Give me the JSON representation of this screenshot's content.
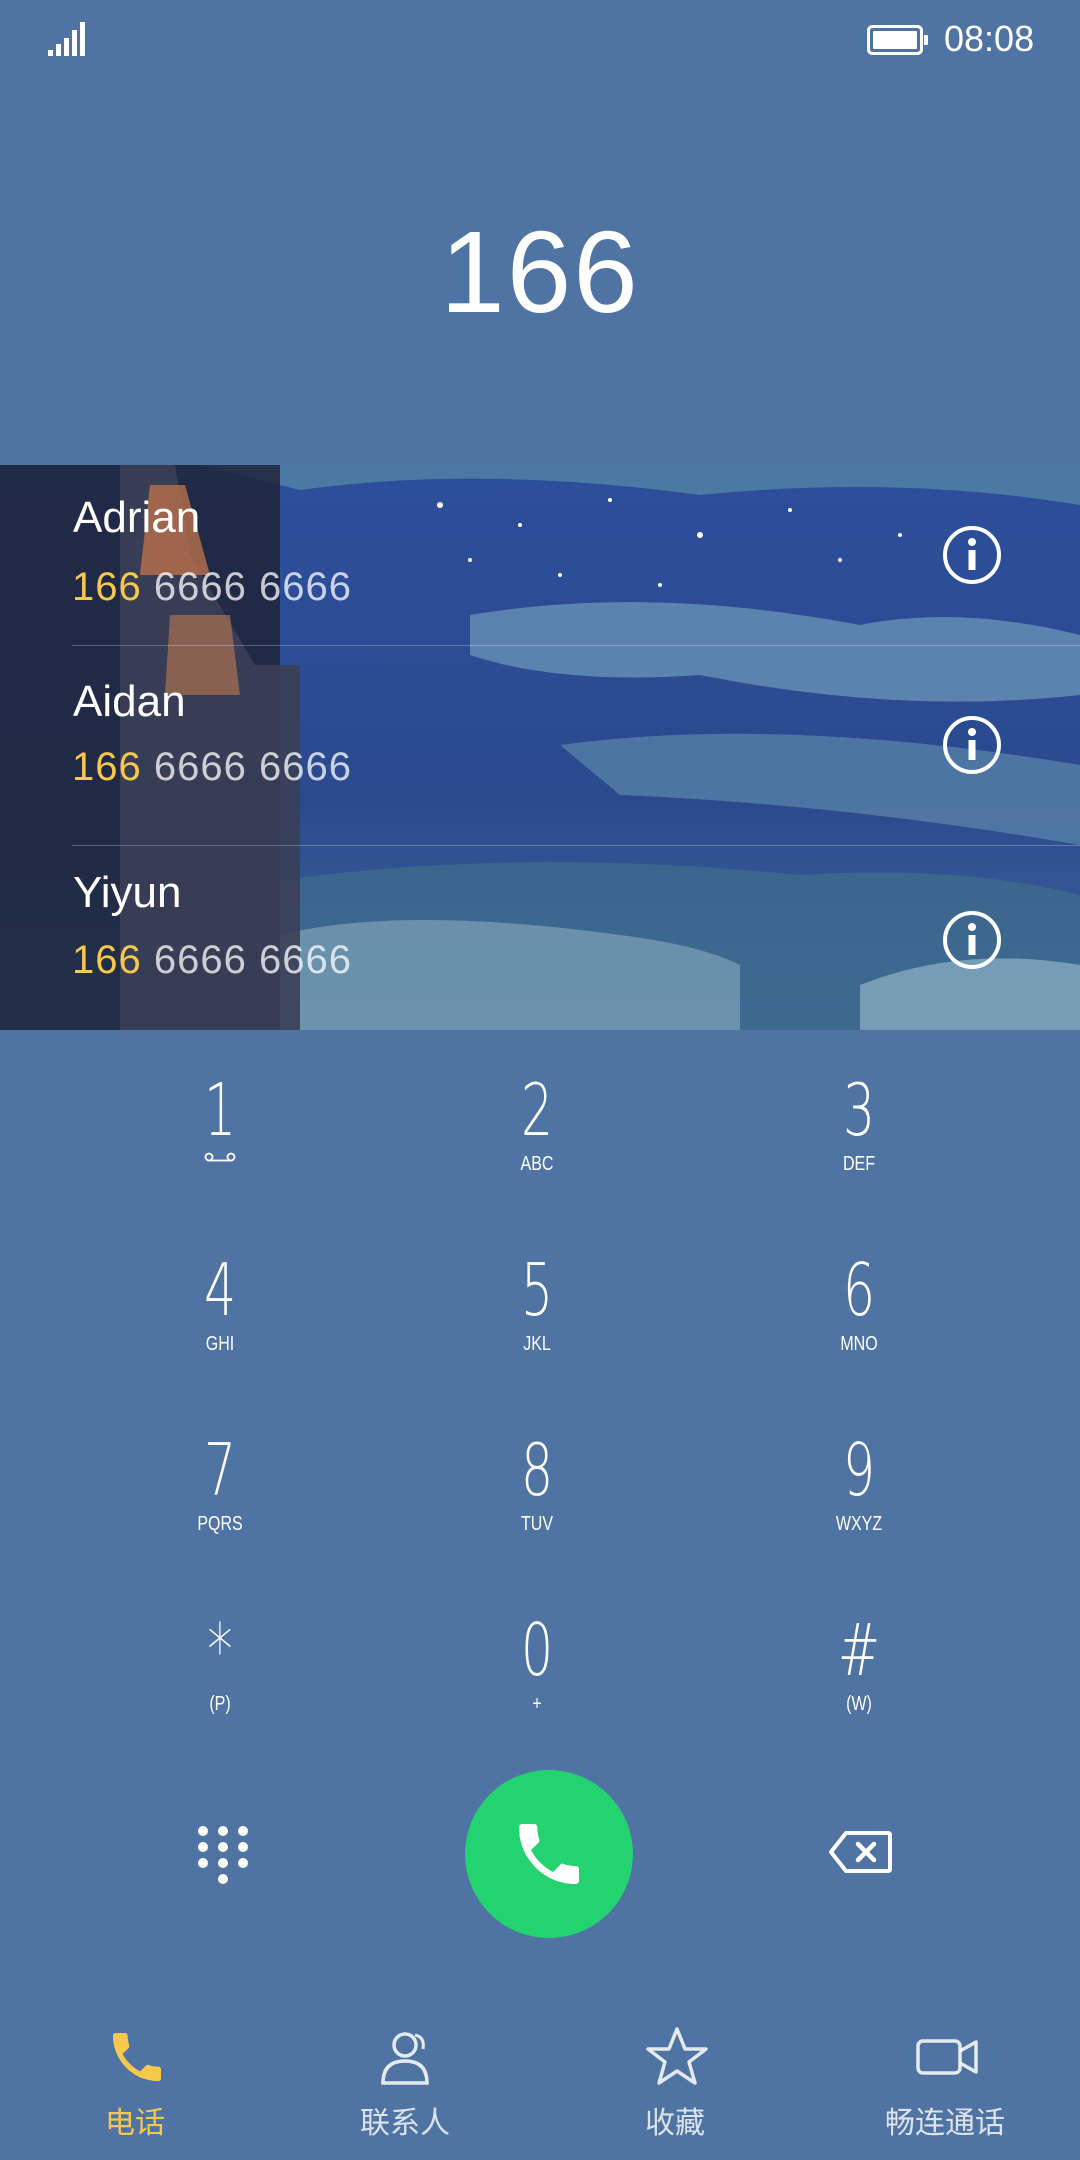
{
  "status_bar": {
    "time": "08:08",
    "signal_icon": "signal-icon",
    "battery_icon": "battery-icon"
  },
  "dialed_number": "166",
  "contacts": [
    {
      "name": "Adrian",
      "number_match": "166",
      "number_rest": " 6666 6666",
      "icon": "info-icon"
    },
    {
      "name": "Aidan",
      "number_match": "166",
      "number_rest": " 6666 6666",
      "icon": "info-icon"
    },
    {
      "name": "Yiyun",
      "number_match": "166",
      "number_rest": " 6666 6666",
      "icon": "info-icon"
    }
  ],
  "keypad": [
    {
      "digit": "1",
      "letters": ""
    },
    {
      "digit": "2",
      "letters": "ABC"
    },
    {
      "digit": "3",
      "letters": "DEF"
    },
    {
      "digit": "4",
      "letters": "GHI"
    },
    {
      "digit": "5",
      "letters": "JKL"
    },
    {
      "digit": "6",
      "letters": "MNO"
    },
    {
      "digit": "7",
      "letters": "PQRS"
    },
    {
      "digit": "8",
      "letters": "TUV"
    },
    {
      "digit": "9",
      "letters": "WXYZ"
    },
    {
      "digit": "*",
      "letters": "(P)"
    },
    {
      "digit": "0",
      "letters": "+"
    },
    {
      "digit": "#",
      "letters": "(W)"
    }
  ],
  "controls": {
    "dialpad_icon": "dialpad-icon",
    "call_icon": "phone-icon",
    "backspace_icon": "backspace-icon"
  },
  "nav": [
    {
      "label": "电话",
      "icon": "phone-icon",
      "active": true
    },
    {
      "label": "联系人",
      "icon": "contacts-icon",
      "active": false
    },
    {
      "label": "收藏",
      "icon": "star-icon",
      "active": false
    },
    {
      "label": "畅连通话",
      "icon": "video-call-icon",
      "active": false
    }
  ],
  "colors": {
    "background": "#4f74a4",
    "accent": "#f6c84c",
    "call_green": "#23d36f"
  }
}
